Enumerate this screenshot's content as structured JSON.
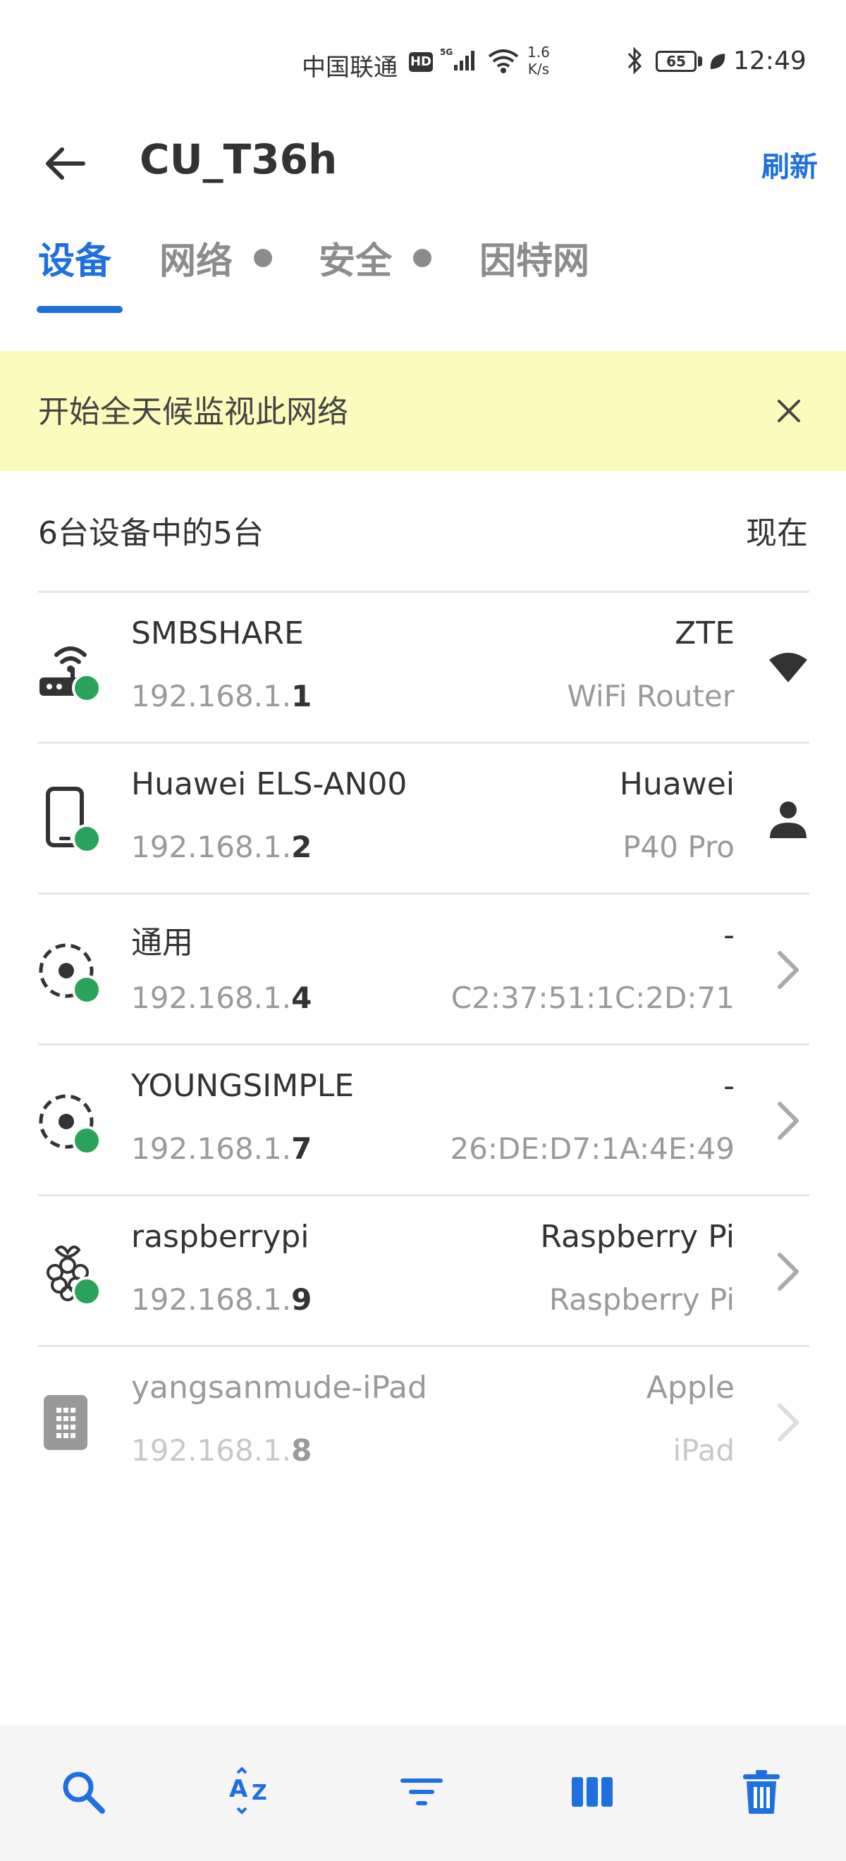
{
  "status_bar": {
    "carrier": "中国联通",
    "hd": "HD",
    "speed_value": "1.6",
    "speed_unit": "K/s",
    "battery": "65",
    "time": "12:49"
  },
  "header": {
    "title": "CU_T36h",
    "refresh_label": "刷新"
  },
  "tabs": [
    {
      "label": "设备",
      "active": true
    },
    {
      "label": "网络",
      "active": false
    },
    {
      "label": "安全",
      "active": false
    },
    {
      "label": "因特网",
      "active": false
    }
  ],
  "banner": {
    "text": "开始全天候监视此网络"
  },
  "summary": {
    "count_text": "6台设备中的5台",
    "time_text": "现在"
  },
  "devices": [
    {
      "name": "SMBSHARE",
      "ip_prefix": "192.168.1.",
      "ip_last": "1",
      "vendor": "ZTE",
      "model": "WiFi Router",
      "icon": "router-icon",
      "right_icon": "wifi-signal-icon",
      "online": true
    },
    {
      "name": "Huawei ELS-AN00",
      "ip_prefix": "192.168.1.",
      "ip_last": "2",
      "vendor": "Huawei",
      "model": "P40 Pro",
      "icon": "phone-icon",
      "right_icon": "person-icon",
      "online": true
    },
    {
      "name": "通用",
      "ip_prefix": "192.168.1.",
      "ip_last": "4",
      "vendor": "-",
      "model": "C2:37:51:1C:2D:71",
      "icon": "generic-device-icon",
      "right_icon": "chevron-right-icon",
      "online": true
    },
    {
      "name": "YOUNGSIMPLE",
      "ip_prefix": "192.168.1.",
      "ip_last": "7",
      "vendor": "-",
      "model": "26:DE:D7:1A:4E:49",
      "icon": "generic-device-icon",
      "right_icon": "chevron-right-icon",
      "online": true
    },
    {
      "name": "raspberrypi",
      "ip_prefix": "192.168.1.",
      "ip_last": "9",
      "vendor": "Raspberry Pi",
      "model": "Raspberry Pi",
      "icon": "raspberry-pi-icon",
      "right_icon": "chevron-right-icon",
      "online": true
    },
    {
      "name": "yangsanmude-iPad",
      "ip_prefix": "192.168.1.",
      "ip_last": "8",
      "vendor": "Apple",
      "model": "iPad",
      "icon": "tablet-icon",
      "right_icon": "chevron-right-icon",
      "online": false
    }
  ],
  "toolbar": {
    "items": [
      "search-icon",
      "sort-az-icon",
      "filter-icon",
      "columns-icon",
      "trash-icon"
    ],
    "accent": "#1e6fe0"
  },
  "colors": {
    "accent": "#1e6fe0",
    "online": "#2aa35a",
    "banner_bg": "#fbfbbe"
  }
}
